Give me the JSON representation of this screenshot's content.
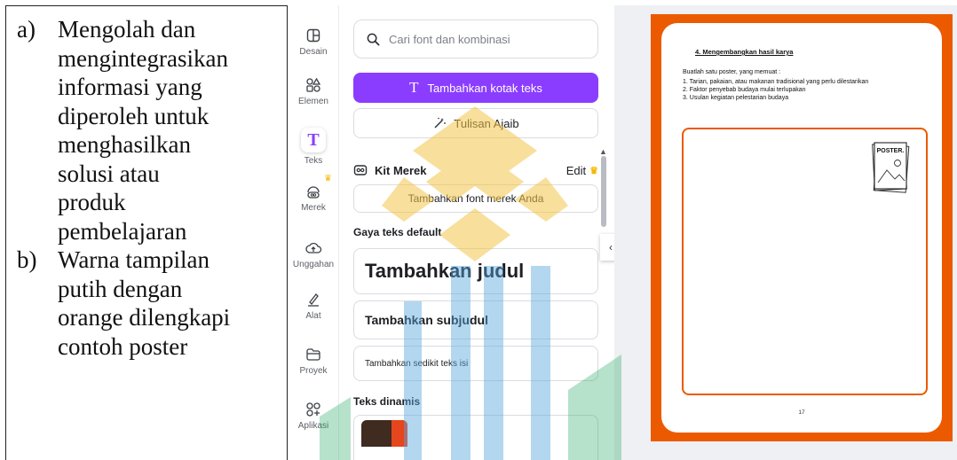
{
  "description_cell": {
    "items": [
      {
        "marker": "a)",
        "text": "Mengolah dan\nmengintegrasikan\ninformasi yang\ndiperoleh untuk\nmenghasilkan\nsolusi atau\nproduk\npembelajaran"
      },
      {
        "marker": "b)",
        "text": "Warna tampilan\nputih dengan\norange dilengkapi\ncontoh poster"
      }
    ]
  },
  "sidebar": {
    "items": [
      {
        "label": "Desain",
        "icon": "layout-icon"
      },
      {
        "label": "Elemen",
        "icon": "shapes-icon"
      },
      {
        "label": "Teks",
        "icon": "text-icon"
      },
      {
        "label": "Merek",
        "icon": "brand-icon"
      },
      {
        "label": "Unggahan",
        "icon": "upload-cloud-icon"
      },
      {
        "label": "Alat",
        "icon": "draw-icon"
      },
      {
        "label": "Proyek",
        "icon": "folder-icon"
      },
      {
        "label": "Aplikasi",
        "icon": "apps-icon"
      }
    ]
  },
  "panel": {
    "search_placeholder": "Cari font dan kombinasi",
    "add_textbox": "Tambahkan kotak teks",
    "magic_write": "Tulisan Ajaib",
    "brand_kit": "Kit Merek",
    "edit": "Edit",
    "add_brand_font": "Tambahkan font merek Anda",
    "default_styles_label": "Gaya teks default",
    "heading": "Tambahkan judul",
    "subheading": "Tambahkan subjudul",
    "body": "Tambahkan sedikit teks isi",
    "dynamic_label": "Teks dinamis"
  },
  "document": {
    "heading": "4. Mengembangkan hasil karya",
    "intro": "Buatlah satu poster,  yang memuat :",
    "items": [
      "1. Tarian, pakaian, atau makanan tradisional yang perlu dilestarikan",
      "2. Faktor penyebab budaya mulai terlupakan",
      "3. Usulan kegiatan pelestarian budaya"
    ],
    "poster_label": "POSTER.",
    "page_number": "17"
  },
  "colors": {
    "accent_purple": "#8b3dff",
    "page_orange": "#ec5a00",
    "watermark_gold": "#f3c54a",
    "watermark_blue": "#5aa7e0",
    "watermark_green": "#2fa86a"
  }
}
